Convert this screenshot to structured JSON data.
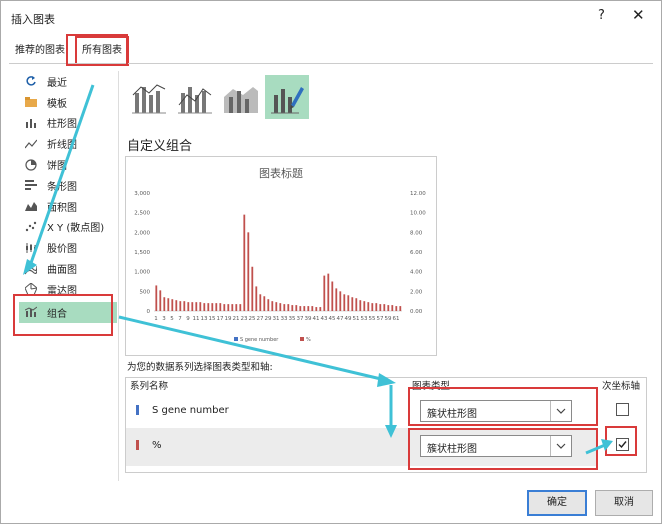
{
  "dialog": {
    "title": "插入图表",
    "help_label": "?",
    "close_label": "✕"
  },
  "tabs": [
    {
      "label": "推荐的图表"
    },
    {
      "label": "所有图表"
    }
  ],
  "sidebar": {
    "items": [
      {
        "label": "最近",
        "icon": "recent-icon"
      },
      {
        "label": "模板",
        "icon": "template-folder-icon"
      },
      {
        "label": "柱形图",
        "icon": "column-chart-icon"
      },
      {
        "label": "折线图",
        "icon": "line-chart-icon"
      },
      {
        "label": "饼图",
        "icon": "pie-chart-icon"
      },
      {
        "label": "条形图",
        "icon": "bar-chart-icon"
      },
      {
        "label": "面积图",
        "icon": "area-chart-icon"
      },
      {
        "label": "X Y (散点图)",
        "icon": "scatter-chart-icon"
      },
      {
        "label": "股价图",
        "icon": "stock-chart-icon"
      },
      {
        "label": "曲面图",
        "icon": "surface-chart-icon"
      },
      {
        "label": "雷达图",
        "icon": "radar-chart-icon"
      },
      {
        "label": "组合",
        "icon": "combo-chart-icon"
      }
    ]
  },
  "main": {
    "heading": "自定义组合",
    "series_prompt": "为您的数据系列选择图表类型和轴:",
    "columns": {
      "series_name": "系列名称",
      "chart_type": "图表类型",
      "secondary_axis": "次坐标轴"
    },
    "series_rows": [
      {
        "name": "S gene number",
        "chart_type": "簇状柱形图",
        "secondary_axis": false,
        "color": "#4472c4"
      },
      {
        "name": "%",
        "chart_type": "簇状柱形图",
        "secondary_axis": true,
        "color": "#c0504d"
      }
    ]
  },
  "buttons": {
    "ok": "确定",
    "cancel": "取消"
  },
  "colors": {
    "accent": "#a8dcc0",
    "highlight_red": "#d93a3a",
    "annotation_arrow": "#3fc1d6"
  },
  "chart_data": {
    "type": "bar",
    "title": "图表标题",
    "x_tick_labels": [
      "1",
      "3",
      "5",
      "7",
      "9",
      "11",
      "13",
      "15",
      "17",
      "19",
      "21",
      "23",
      "25",
      "27",
      "29",
      "31",
      "33",
      "35",
      "37",
      "39",
      "41",
      "43",
      "45",
      "47",
      "49",
      "51",
      "53",
      "55",
      "57",
      "59",
      "61"
    ],
    "x": [
      1,
      2,
      3,
      4,
      5,
      6,
      7,
      8,
      9,
      10,
      11,
      12,
      13,
      14,
      15,
      16,
      17,
      18,
      19,
      20,
      21,
      22,
      23,
      24,
      25,
      26,
      27,
      28,
      29,
      30,
      31,
      32,
      33,
      34,
      35,
      36,
      37,
      38,
      39,
      40,
      41,
      42,
      43,
      44,
      45,
      46,
      47,
      48,
      49,
      50,
      51,
      52,
      53,
      54,
      55,
      56,
      57,
      58,
      59,
      60,
      61,
      62
    ],
    "series": [
      {
        "name": "S gene number",
        "axis": "primary",
        "color": "#4472c4",
        "values": [
          0,
          0,
          0,
          0,
          0,
          0,
          0,
          0,
          0,
          0,
          0,
          0,
          0,
          0,
          0,
          0,
          0,
          0,
          0,
          0,
          0,
          0,
          0,
          0,
          0,
          0,
          0,
          0,
          0,
          0,
          0,
          0,
          0,
          0,
          0,
          0,
          0,
          0,
          0,
          0,
          0,
          0,
          0,
          0,
          0,
          0,
          0,
          0,
          0,
          0,
          0,
          0,
          0,
          0,
          0,
          0,
          0,
          0,
          0,
          0,
          0,
          0
        ]
      },
      {
        "name": "%",
        "axis": "secondary",
        "color": "#c0504d",
        "values": [
          2.6,
          2.1,
          1.4,
          1.3,
          1.2,
          1.1,
          1.0,
          1.0,
          0.9,
          0.9,
          0.9,
          0.9,
          0.8,
          0.8,
          0.8,
          0.8,
          0.8,
          0.7,
          0.7,
          0.7,
          0.7,
          0.7,
          9.8,
          8.0,
          4.5,
          2.5,
          1.7,
          1.5,
          1.2,
          1.0,
          0.9,
          0.8,
          0.7,
          0.7,
          0.6,
          0.6,
          0.5,
          0.5,
          0.5,
          0.5,
          0.4,
          0.4,
          3.6,
          3.8,
          3.0,
          2.3,
          2.0,
          1.7,
          1.6,
          1.4,
          1.3,
          1.1,
          1.0,
          0.9,
          0.8,
          0.8,
          0.7,
          0.7,
          0.6,
          0.6,
          0.5,
          0.5
        ]
      }
    ],
    "y_ticks": [
      "0",
      "500",
      "1,000",
      "1,500",
      "2,000",
      "2,500",
      "3,000"
    ],
    "ylim": [
      0,
      3000
    ],
    "y2_ticks": [
      "0.00",
      "2.00",
      "4.00",
      "6.00",
      "8.00",
      "10.00",
      "12.00"
    ],
    "y2lim": [
      0,
      12
    ],
    "legend": [
      "S gene number",
      "%"
    ],
    "legend_position": "bottom",
    "grid": false
  }
}
